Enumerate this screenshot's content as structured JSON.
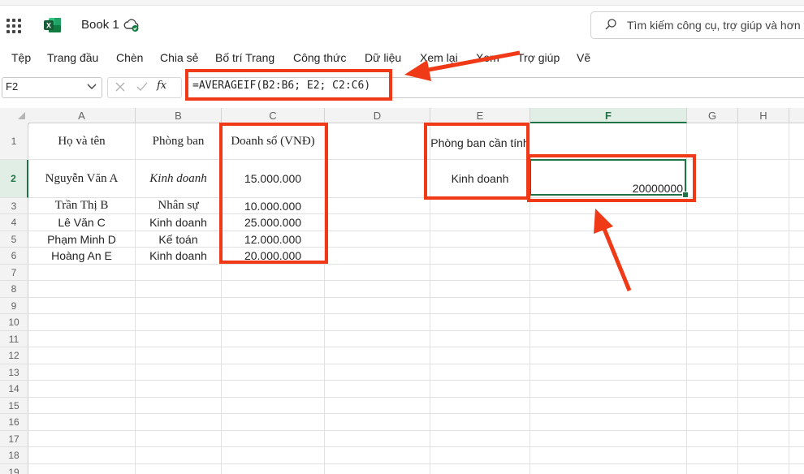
{
  "app": {
    "title": "Book 1",
    "search_placeholder": "Tìm kiếm công cụ, trợ giúp và hơn t"
  },
  "ribbon": {
    "tabs": [
      "Tệp",
      "Trang đầu",
      "Chèn",
      "Chia sẻ",
      "Bố trí Trang",
      "Công thức",
      "Dữ liệu",
      "Xem lại",
      "Xem",
      "Trợ giúp",
      "Vẽ"
    ]
  },
  "formula_bar": {
    "name_box": "F2",
    "fx_label": "fx",
    "formula": "=AVERAGEIF(B2:B6; E2; C2:C6)"
  },
  "grid": {
    "columns": [
      "A",
      "B",
      "C",
      "D",
      "E",
      "F",
      "G",
      "H"
    ],
    "selected_column": "F",
    "rows": [
      "1",
      "2",
      "3",
      "4",
      "5",
      "6",
      "7",
      "8",
      "9",
      "10",
      "11",
      "12",
      "13",
      "14",
      "15",
      "16",
      "17",
      "18",
      "19"
    ],
    "selected_row": "2",
    "headers": {
      "A1": "Họ và tên",
      "B1": "Phòng ban",
      "C1": "Doanh số (VNĐ)",
      "E1": "Phòng ban cần tính"
    },
    "data": [
      {
        "name": "Nguyễn Văn A",
        "dept": "Kinh doanh",
        "sales": "15.000.000"
      },
      {
        "name": "Trần Thị B",
        "dept": "Nhân sự",
        "sales": "10.000.000"
      },
      {
        "name": "Lê Văn C",
        "dept": "Kinh doanh",
        "sales": "25.000.000"
      },
      {
        "name": "Phạm Minh D",
        "dept": "Kế toán",
        "sales": "12.000.000"
      },
      {
        "name": "Hoàng An E",
        "dept": "Kinh doanh",
        "sales": "20.000.000"
      }
    ],
    "criteria_E2": "Kinh doanh",
    "result_F2": "20000000"
  },
  "colors": {
    "accent": "#217346",
    "annotation": "#f03a17"
  },
  "icons": [
    "app-launcher-icon",
    "excel-icon",
    "cloud-saved-icon",
    "search-icon",
    "chevron-down-icon",
    "cancel-icon",
    "confirm-icon"
  ]
}
